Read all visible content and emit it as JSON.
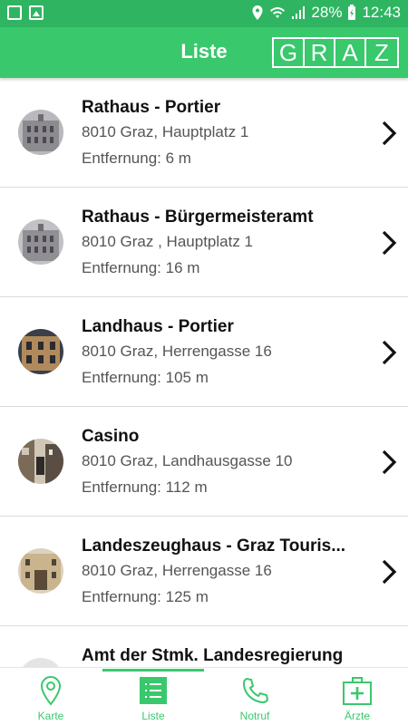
{
  "status_bar": {
    "battery": "28%",
    "time": "12:43"
  },
  "app_bar": {
    "title": "Liste",
    "logo_letters": [
      "G",
      "R",
      "A",
      "Z"
    ]
  },
  "list": {
    "items": [
      {
        "name": "Rathaus - Portier",
        "address": "8010 Graz, Hauptplatz 1",
        "distance": "Entfernung: 6 m"
      },
      {
        "name": "Rathaus - Bürgermeisteramt",
        "address": "8010 Graz , Hauptplatz 1",
        "distance": "Entfernung: 16 m"
      },
      {
        "name": "Landhaus - Portier",
        "address": "8010 Graz, Herrengasse 16",
        "distance": "Entfernung: 105 m"
      },
      {
        "name": "Casino",
        "address": "8010 Graz, Landhausgasse 10",
        "distance": "Entfernung: 112 m"
      },
      {
        "name": "Landeszeughaus - Graz Touris...",
        "address": "8010 Graz, Herrengasse 16",
        "distance": "Entfernung: 125 m"
      },
      {
        "name": "Amt der Stmk. Landesregierung",
        "address": "",
        "distance": ""
      }
    ]
  },
  "bottom_nav": {
    "items": [
      {
        "label": "Karte",
        "icon": "map-pin-icon"
      },
      {
        "label": "Liste",
        "icon": "list-icon",
        "active": true
      },
      {
        "label": "Notruf",
        "icon": "phone-icon"
      },
      {
        "label": "Ärzte",
        "icon": "medical-kit-icon"
      }
    ]
  },
  "colors": {
    "accent": "#39c86c",
    "status_bar": "#2fb562"
  }
}
